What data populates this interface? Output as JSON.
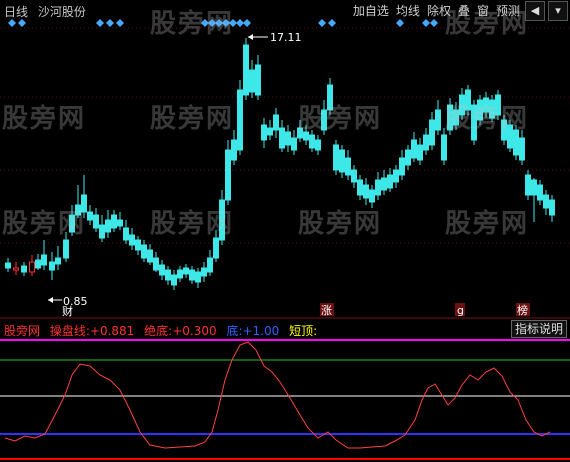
{
  "header": {
    "period": "日线",
    "stock_name": "沙河股份",
    "menu": [
      "加自选",
      "均线",
      "除权",
      "叠",
      "窗",
      "预测"
    ]
  },
  "price_chart": {
    "high_label": "17.11",
    "low_label": "0.85",
    "markers": [
      "财",
      "涨",
      "g",
      "榜"
    ]
  },
  "indicator": {
    "name": "股旁网",
    "items": [
      {
        "label": "操盘线:",
        "value": "+0.881",
        "color": "#ff3030"
      },
      {
        "label": "绝底:",
        "value": "+0.300",
        "color": "#ff3030"
      },
      {
        "label": "底:",
        "value": "+1.00",
        "color": "#3060ff"
      },
      {
        "label": "短顶:",
        "value": "",
        "color": "#ffff00"
      }
    ],
    "help": "指标说明"
  },
  "watermark": "股旁网",
  "colors": {
    "up": "#ff3030",
    "down": "#3ee8e8",
    "diamond": "#44aaff",
    "osc": "#ff4040"
  }
}
